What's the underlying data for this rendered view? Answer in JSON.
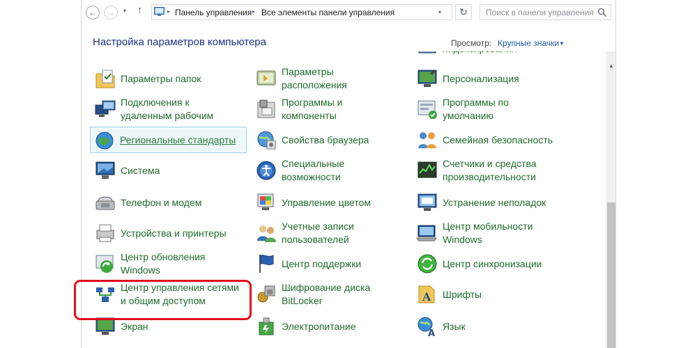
{
  "nav": {
    "back_glyph": "←",
    "forward_glyph": "→",
    "recent_glyph": "▾",
    "up_glyph": "↑",
    "breadcrumb": [
      "Панель управления",
      "Все элементы панели управления"
    ],
    "refresh_glyph": "↻",
    "search_placeholder": "Поиск в панели управления"
  },
  "header": {
    "title": "Настройка параметров компьютера",
    "view_label": "Просмотр:",
    "view_value": "Крупные значки"
  },
  "items": [
    {
      "label_lines": [
        "индексирования"
      ],
      "icon": "indexing-icon"
    },
    {
      "label_lines": [
        "Параметры папок"
      ],
      "icon": "folder-options-icon"
    },
    {
      "label_lines": [
        "Параметры",
        "расположения"
      ],
      "icon": "location-settings-icon"
    },
    {
      "label_lines": [
        "Персонализация"
      ],
      "icon": "personalization-icon"
    },
    {
      "label_lines": [
        "Подключения к",
        "удаленным рабочим"
      ],
      "icon": "remote-desktop-icon"
    },
    {
      "label_lines": [
        "Программы и",
        "компоненты"
      ],
      "icon": "programs-features-icon"
    },
    {
      "label_lines": [
        "Программы по",
        "умолчанию"
      ],
      "icon": "default-programs-icon"
    },
    {
      "label_lines": [
        "Региональные стандарты"
      ],
      "icon": "region-globe-icon"
    },
    {
      "label_lines": [
        "Свойства браузера"
      ],
      "icon": "internet-options-icon"
    },
    {
      "label_lines": [
        "Семейная безопасность"
      ],
      "icon": "family-safety-icon"
    },
    {
      "label_lines": [
        "Система"
      ],
      "icon": "system-icon"
    },
    {
      "label_lines": [
        "Специальные",
        "возможности"
      ],
      "icon": "ease-of-access-icon"
    },
    {
      "label_lines": [
        "Счетчики и средства",
        "производительности"
      ],
      "icon": "performance-icon"
    },
    {
      "label_lines": [
        "Телефон и модем"
      ],
      "icon": "phone-modem-icon"
    },
    {
      "label_lines": [
        "Управление цветом"
      ],
      "icon": "color-management-icon"
    },
    {
      "label_lines": [
        "Устранение неполадок"
      ],
      "icon": "troubleshooting-icon"
    },
    {
      "label_lines": [
        "Устройства и принтеры"
      ],
      "icon": "devices-printers-icon"
    },
    {
      "label_lines": [
        "Учетные записи",
        "пользователей"
      ],
      "icon": "user-accounts-icon"
    },
    {
      "label_lines": [
        "Центр мобильности",
        "Windows"
      ],
      "icon": "mobility-center-icon"
    },
    {
      "label_lines": [
        "Центр обновления",
        "Windows"
      ],
      "icon": "windows-update-icon"
    },
    {
      "label_lines": [
        "Центр поддержки"
      ],
      "icon": "action-center-flag-icon"
    },
    {
      "label_lines": [
        "Центр синхронизации"
      ],
      "icon": "sync-center-icon"
    },
    {
      "label_lines": [
        "Центр управления сетями",
        "и общим доступом"
      ],
      "icon": "network-sharing-icon"
    },
    {
      "label_lines": [
        "Шифрование диска",
        "BitLocker"
      ],
      "icon": "bitlocker-icon"
    },
    {
      "label_lines": [
        "Шрифты"
      ],
      "icon": "fonts-icon"
    },
    {
      "label_lines": [
        "Экран"
      ],
      "icon": "display-icon"
    },
    {
      "label_lines": [
        "Электропитание"
      ],
      "icon": "power-options-icon"
    },
    {
      "label_lines": [
        "Язык"
      ],
      "icon": "language-icon"
    }
  ],
  "selected_item_index": 7,
  "highlighted_item_index": 22,
  "colors": {
    "item_text": "#1f6b2f",
    "title_text": "#1e3287",
    "highlight_border": "#e3101b",
    "selected_border": "#9ed4e5"
  }
}
